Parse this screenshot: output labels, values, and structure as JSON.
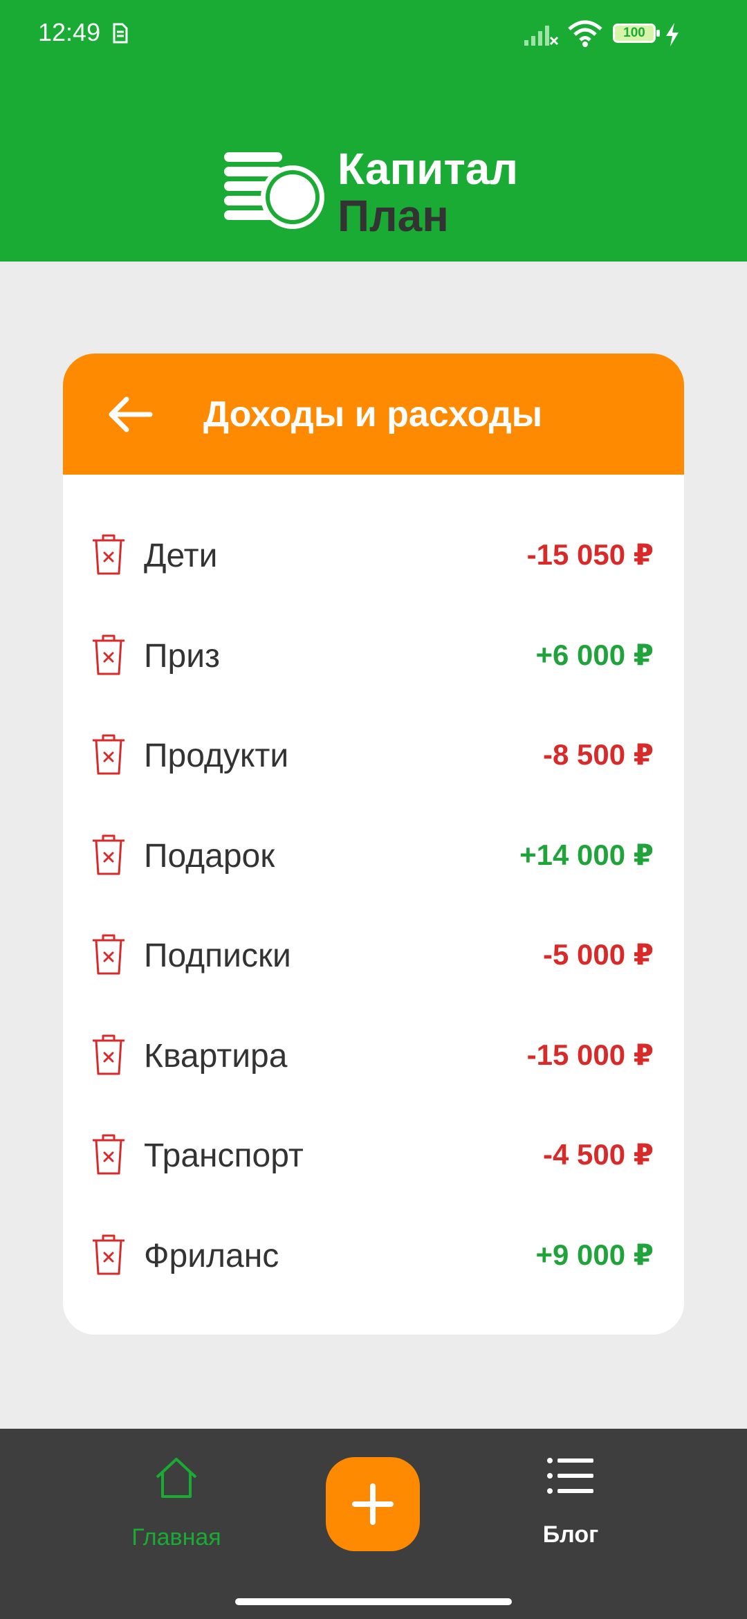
{
  "status_bar": {
    "time": "12:49",
    "battery": "100",
    "icons": [
      "sim-icon",
      "signal-icon",
      "wifi-icon",
      "battery-icon",
      "charging-icon"
    ]
  },
  "brand": {
    "line1": "Капитал",
    "line2": "План",
    "icon": "coins-icon"
  },
  "card": {
    "title": "Доходы и расходы",
    "back_icon": "arrow-left-icon"
  },
  "transactions": [
    {
      "label": "Дети",
      "amount": "-15 050 ₽",
      "kind": "expense"
    },
    {
      "label": "Приз",
      "amount": "+6 000 ₽",
      "kind": "income"
    },
    {
      "label": "Продукти",
      "amount": "-8 500 ₽",
      "kind": "expense"
    },
    {
      "label": "Подарок",
      "amount": "+14 000 ₽",
      "kind": "income"
    },
    {
      "label": "Подписки",
      "amount": "-5 000 ₽",
      "kind": "expense"
    },
    {
      "label": "Квартира",
      "amount": "-15 000 ₽",
      "kind": "expense"
    },
    {
      "label": "Транспорт",
      "amount": "-4 500 ₽",
      "kind": "expense"
    },
    {
      "label": "Фриланс",
      "amount": "+9 000 ₽",
      "kind": "income"
    }
  ],
  "nav": {
    "home_label": "Главная",
    "blog_label": "Блог",
    "home_icon": "home-icon",
    "add_icon": "plus-icon",
    "blog_icon": "list-icon"
  },
  "colors": {
    "brand_green": "#19ab33",
    "accent_orange": "#fd8a00",
    "income": "#1fa33a",
    "expense": "#d92a2a",
    "nav_bg": "#3e3e3e"
  }
}
